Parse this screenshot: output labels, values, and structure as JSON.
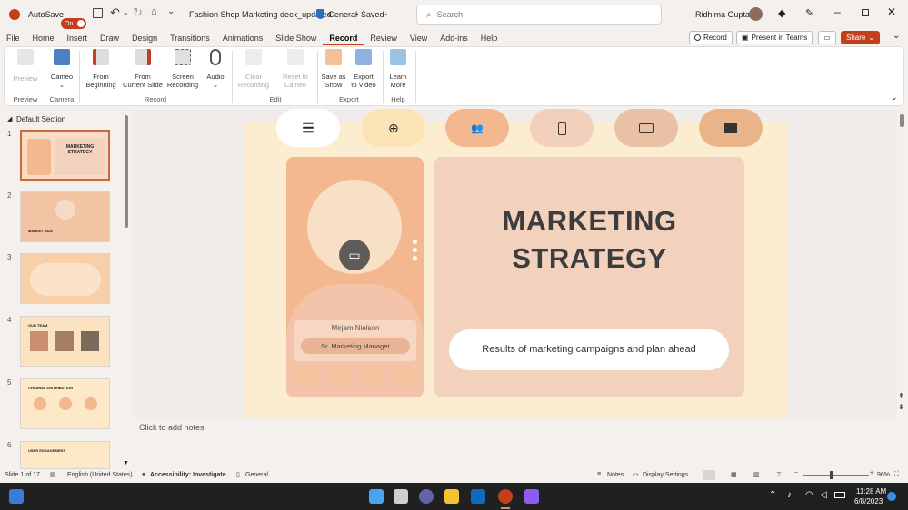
{
  "titlebar": {
    "autosave_label": "AutoSave",
    "autosave_state": "On",
    "doc_title": "Fashion Shop Marketing deck_updated",
    "sensitivity": "General",
    "save_status": "Saved",
    "search_placeholder": "Search",
    "user_name": "Ridhima Gupta"
  },
  "tabs": [
    "File",
    "Home",
    "Insert",
    "Draw",
    "Design",
    "Transitions",
    "Animations",
    "Slide Show",
    "Record",
    "Review",
    "View",
    "Add-ins",
    "Help"
  ],
  "active_tab": "Record",
  "header_buttons": {
    "record": "Record",
    "present_teams": "Present in Teams",
    "share": "Share"
  },
  "ribbon": {
    "preview": "Preview",
    "cameo": "Cameo",
    "from_beginning_1": "From",
    "from_beginning_2": "Beginning",
    "from_current_1": "From",
    "from_current_2": "Current Slide",
    "screen_rec_1": "Screen",
    "screen_rec_2": "Recording",
    "audio": "Audio",
    "clear_rec_1": "Clear",
    "clear_rec_2": "Recording",
    "reset_cameo_1": "Reset to",
    "reset_cameo_2": "Cameo",
    "save_show_1": "Save as",
    "save_show_2": "Show",
    "export_video_1": "Export",
    "export_video_2": "to Video",
    "learn_more_1": "Learn",
    "learn_more_2": "More",
    "groups": {
      "preview": "Preview",
      "camera": "Camera",
      "record": "Record",
      "edit": "Edit",
      "export": "Export",
      "help": "Help"
    }
  },
  "panel": {
    "section": "Default Section",
    "thumbs": [
      {
        "num": "1",
        "title": "MARKETING STRATEGY"
      },
      {
        "num": "2",
        "title": "MARKET SIZE"
      },
      {
        "num": "3",
        "title": ""
      },
      {
        "num": "4",
        "title": "OUR TEAM"
      },
      {
        "num": "5",
        "title": "CHANNEL DISTRIBUTION"
      },
      {
        "num": "6",
        "title": "USER ENGAGEMENT"
      }
    ]
  },
  "slide": {
    "title_line1": "MARKETING",
    "title_line2": "STRATEGY",
    "subtitle": "Results of marketing campaigns and plan ahead",
    "person_name": "Mirjam Nielson",
    "person_role": "Sr. Marketing Manager"
  },
  "notes_placeholder": "Click to add notes",
  "status": {
    "slide_info": "Slide 1 of 17",
    "language": "English (United States)",
    "accessibility": "Accessibility: Investigate",
    "sensitivity": "General",
    "notes": "Notes",
    "display_settings": "Display Settings",
    "zoom": "96%"
  },
  "taskbar": {
    "time": "11:28 AM",
    "date": "6/8/2023"
  },
  "colors": {
    "accent": "#c43e1c",
    "slide_bg": "#fdedd0",
    "peach": "#f3b88f",
    "peach_light": "#f3d3bd"
  }
}
